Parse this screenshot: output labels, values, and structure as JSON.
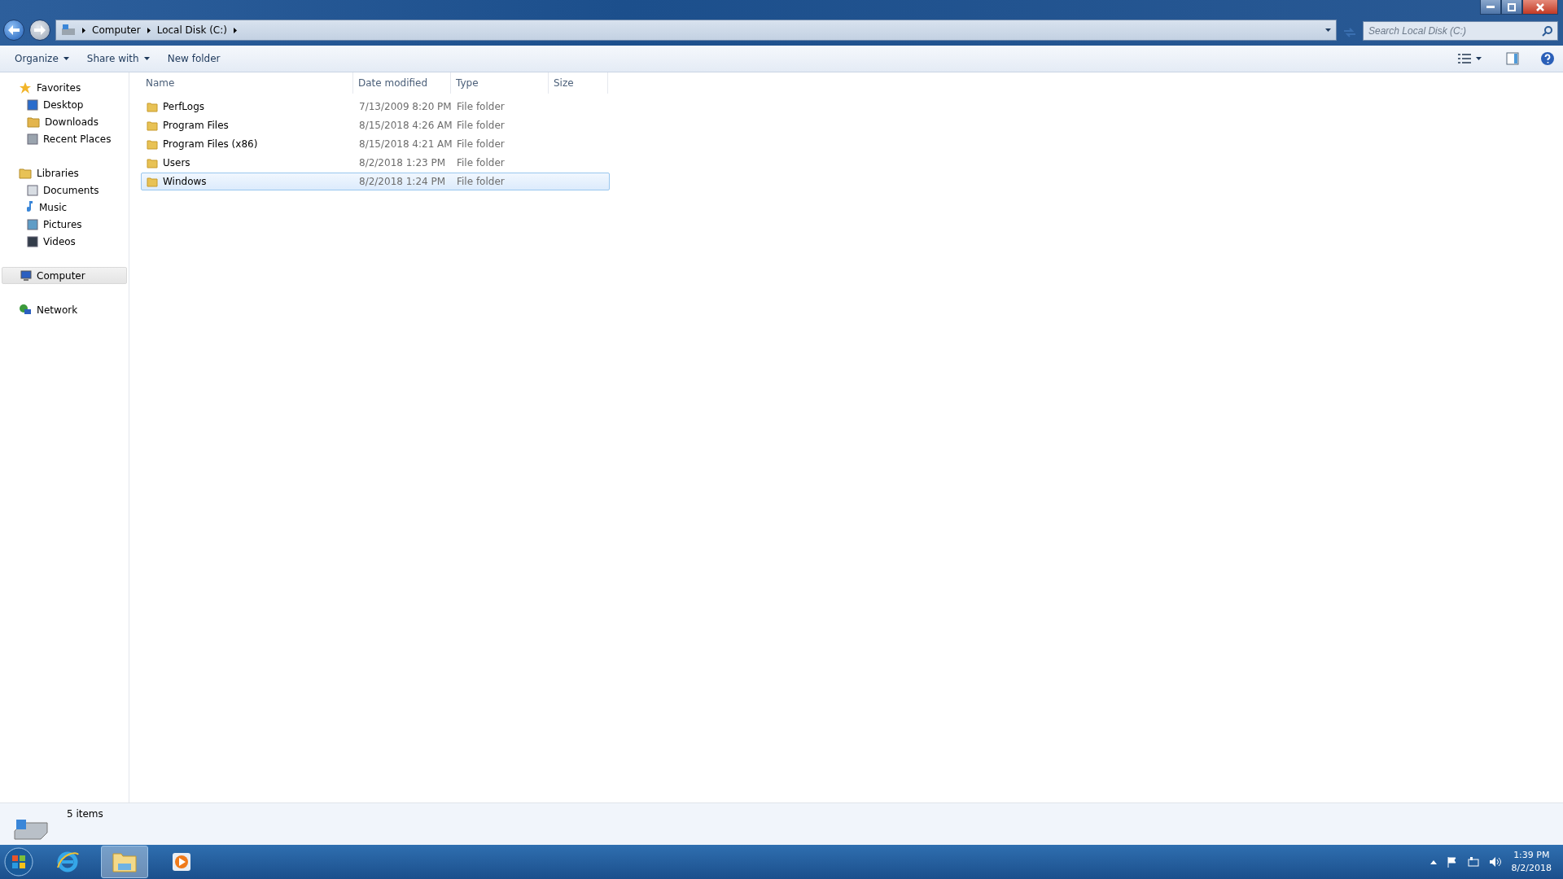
{
  "address": {
    "crumbs": [
      "Computer",
      "Local Disk (C:)"
    ]
  },
  "search": {
    "placeholder": "Search Local Disk (C:)"
  },
  "commands": [
    {
      "label": "Organize",
      "dropdown": true
    },
    {
      "label": "Share with",
      "dropdown": true
    },
    {
      "label": "New folder",
      "dropdown": false
    }
  ],
  "sidebar": {
    "groups": [
      {
        "label": "Favorites",
        "kind": "favorites",
        "selected": false,
        "children": [
          {
            "label": "Desktop",
            "kind": "desktop"
          },
          {
            "label": "Downloads",
            "kind": "downloads"
          },
          {
            "label": "Recent Places",
            "kind": "recent"
          }
        ]
      },
      {
        "label": "Libraries",
        "kind": "libraries",
        "selected": false,
        "children": [
          {
            "label": "Documents",
            "kind": "documents"
          },
          {
            "label": "Music",
            "kind": "music"
          },
          {
            "label": "Pictures",
            "kind": "pictures"
          },
          {
            "label": "Videos",
            "kind": "videos"
          }
        ]
      },
      {
        "label": "Computer",
        "kind": "computer",
        "selected": true
      },
      {
        "label": "Network",
        "kind": "network",
        "selected": false
      }
    ]
  },
  "table": {
    "columns": [
      "Name",
      "Date modified",
      "Type",
      "Size"
    ],
    "rows": [
      {
        "name": "PerfLogs",
        "date": "7/13/2009 8:20 PM",
        "type": "File folder",
        "selected": false
      },
      {
        "name": "Program Files",
        "date": "8/15/2018 4:26 AM",
        "type": "File folder",
        "selected": false
      },
      {
        "name": "Program Files (x86)",
        "date": "8/15/2018 4:21 AM",
        "type": "File folder",
        "selected": false
      },
      {
        "name": "Users",
        "date": "8/2/2018 1:23 PM",
        "type": "File folder",
        "selected": false
      },
      {
        "name": "Windows",
        "date": "8/2/2018 1:24 PM",
        "type": "File folder",
        "selected": true
      }
    ]
  },
  "status_bar": {
    "text": "5 items"
  },
  "taskbar": {
    "apps": [
      {
        "kind": "ie",
        "selected": false
      },
      {
        "kind": "explorer",
        "selected": true
      },
      {
        "kind": "media",
        "selected": false
      }
    ],
    "time": "1:39 PM",
    "date": "8/2/2018"
  }
}
